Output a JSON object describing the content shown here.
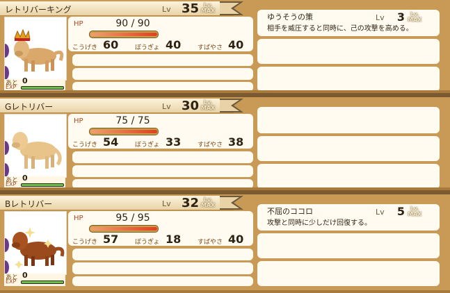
{
  "colors": {
    "accent_hp": "#e04020",
    "exp_green": "#6cc04a",
    "frame": "#c89a55"
  },
  "lv_label": "Lv",
  "lvmax_label": [
    "Lv.",
    "MAX"
  ],
  "hp_label": "HP",
  "exp_labels": {
    "aito": "あと",
    "exp": "EXP"
  },
  "stat_labels": {
    "attack": "こうげき",
    "defense": "ぼうぎょ",
    "speed": "すばやさ"
  },
  "units": [
    {
      "name": "レトリバーキング",
      "level": "35",
      "hp": "90 / 90",
      "hp_fraction": 1.0,
      "attack": "60",
      "defense": "40",
      "speed": "40",
      "exp_remaining": "0",
      "exp_fraction": 1.0,
      "portrait": "golden-retriever-king-crown-icon",
      "skill": {
        "name": "ゆうそうの策",
        "level": "3",
        "desc": "相手を威圧すると同時に、己の攻撃を高める。"
      }
    },
    {
      "name": "Gレトリバー",
      "level": "30",
      "hp": "75 / 75",
      "hp_fraction": 1.0,
      "attack": "54",
      "defense": "33",
      "speed": "38",
      "exp_remaining": "0",
      "exp_fraction": 1.0,
      "portrait": "golden-retriever-icon"
    },
    {
      "name": "Bレトリバー",
      "level": "32",
      "hp": "95 / 95",
      "hp_fraction": 1.0,
      "attack": "57",
      "defense": "18",
      "speed": "40",
      "exp_remaining": "0",
      "exp_fraction": 1.0,
      "portrait": "brown-retriever-sparkle-icon",
      "skill": {
        "name": "不屈のココロ",
        "level": "5",
        "desc": "攻撃と同時に少しだけ回復する。"
      }
    }
  ]
}
